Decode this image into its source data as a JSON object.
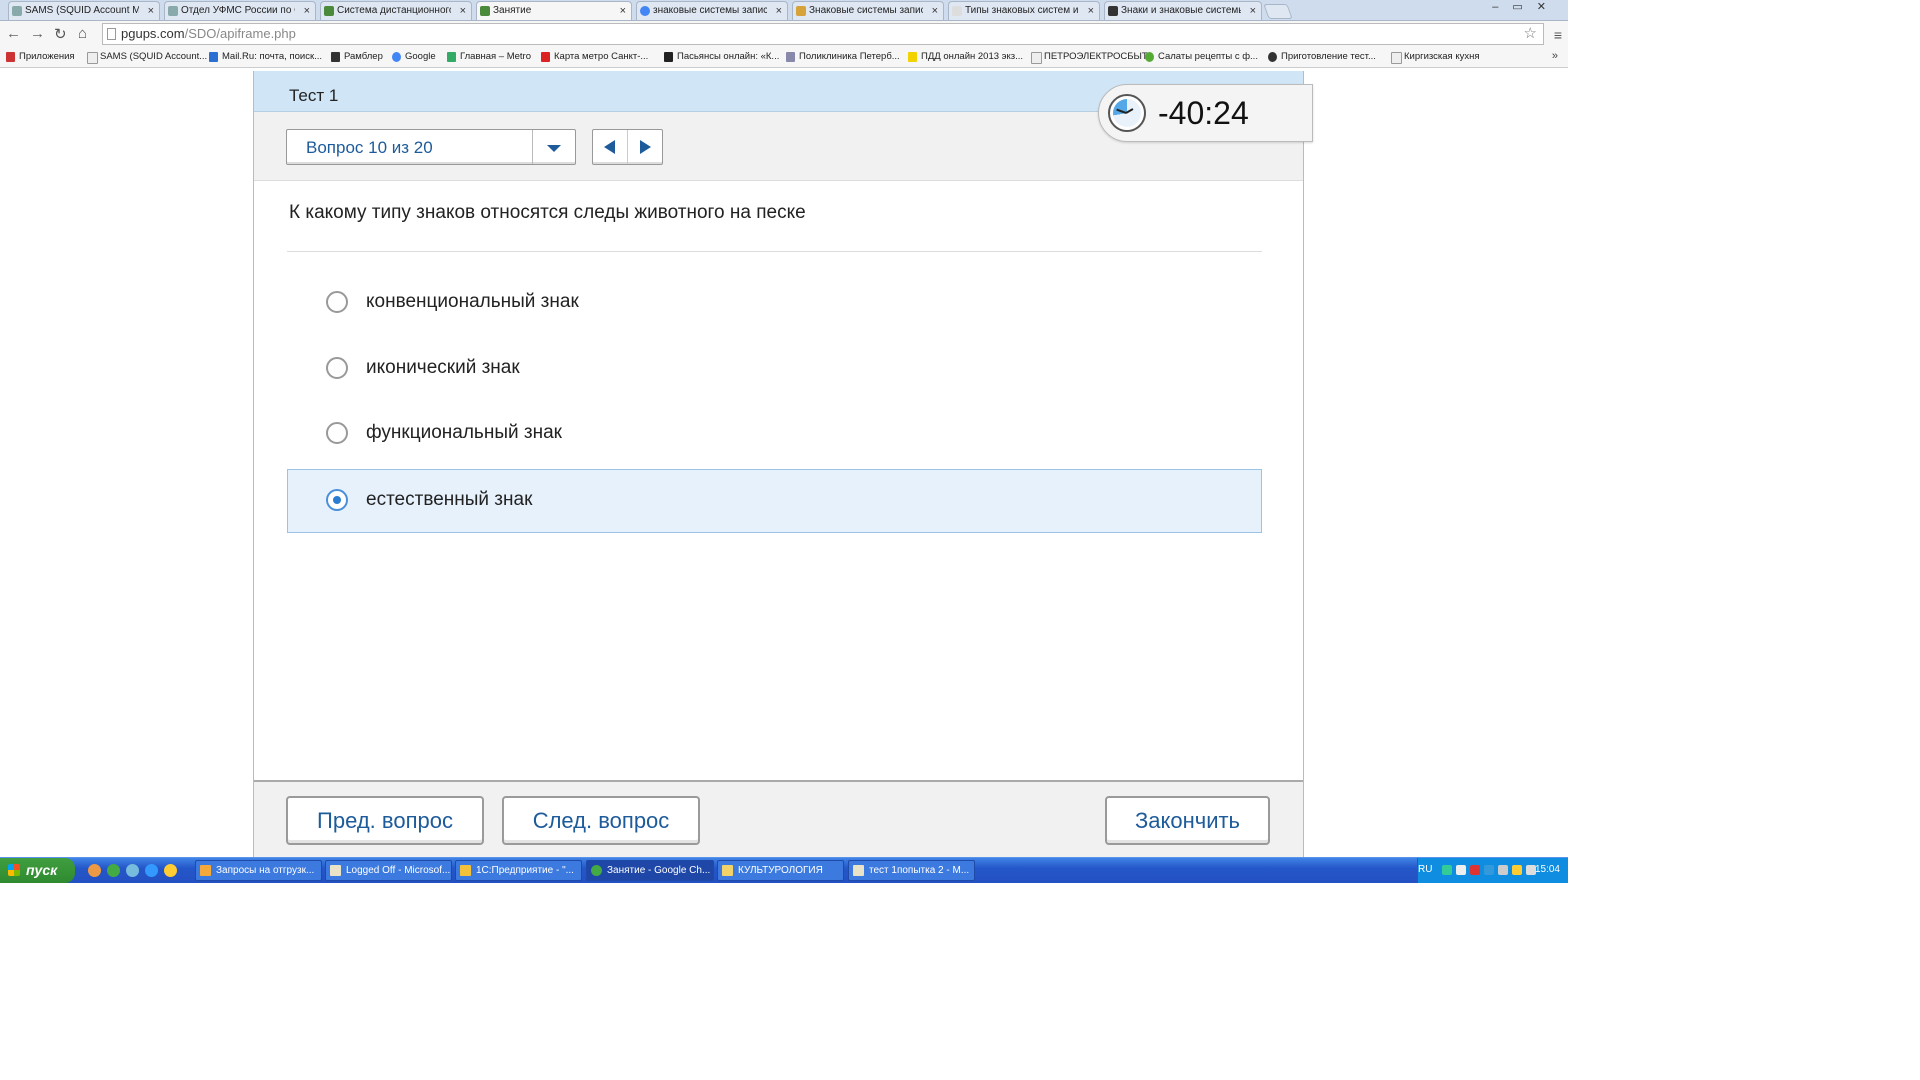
{
  "browser": {
    "tabs": [
      {
        "label": "SAMS (SQUID Account Mana",
        "active": false
      },
      {
        "label": "Отдел УФМС России по Санкт",
        "active": false
      },
      {
        "label": "Система дистанционного о",
        "active": false
      },
      {
        "label": "Занятие",
        "active": true
      },
      {
        "label": "знаковые системы записи -",
        "active": false
      },
      {
        "label": "Знаковые системы записи",
        "active": false
      },
      {
        "label": "Типы знаковых систем и их",
        "active": false
      },
      {
        "label": "Знаки и знаковые системы",
        "active": false
      }
    ],
    "url_domain": "pgups.com",
    "url_path": "/SDO/apiframe.php",
    "bookmarks": [
      "Приложения",
      "SAMS (SQUID Account...",
      "Mail.Ru: почта, поиск...",
      "Рамблер",
      "Google",
      "Главная – Metro",
      "Карта метро Санкт-...",
      "Пасьянсы онлайн: «К...",
      "Поликлиника Петерб...",
      "ПДД онлайн 2013 экз...",
      "ПЕТРОЭЛЕКТРОСБЫТ",
      "Салаты рецепты с ф...",
      "Приготовление тест...",
      "Киргизская кухня"
    ]
  },
  "test": {
    "title": "Тест 1",
    "question_selector": "Вопрос 10 из 20",
    "timer": "-40:24",
    "question": "К какому типу знаков относятся следы животного на песке",
    "options": [
      {
        "label": "конвенциональный знак",
        "selected": false
      },
      {
        "label": "иконический знак",
        "selected": false
      },
      {
        "label": "функциональный знак",
        "selected": false
      },
      {
        "label": "естественный знак",
        "selected": true
      }
    ],
    "buttons": {
      "prev": "Пред. вопрос",
      "next": "След. вопрос",
      "finish": "Закончить"
    }
  },
  "taskbar": {
    "start_label": "пуск",
    "tasks": [
      {
        "label": "Запросы на отгрузк...",
        "active": false
      },
      {
        "label": "Logged Off - Microsof...",
        "active": false
      },
      {
        "label": "1С:Предприятие - \"...",
        "active": false
      },
      {
        "label": "Занятие - Google Ch...",
        "active": true
      },
      {
        "label": "КУЛЬТУРОЛОГИЯ",
        "active": false
      },
      {
        "label": "тест 1попытка 2 - M...",
        "active": false
      }
    ],
    "language": "RU",
    "clock": "15:04"
  },
  "colors": {
    "accent": "#1d5b9a",
    "header_bg": "#d0e6f7",
    "selected_bg": "#e6f1fb"
  }
}
